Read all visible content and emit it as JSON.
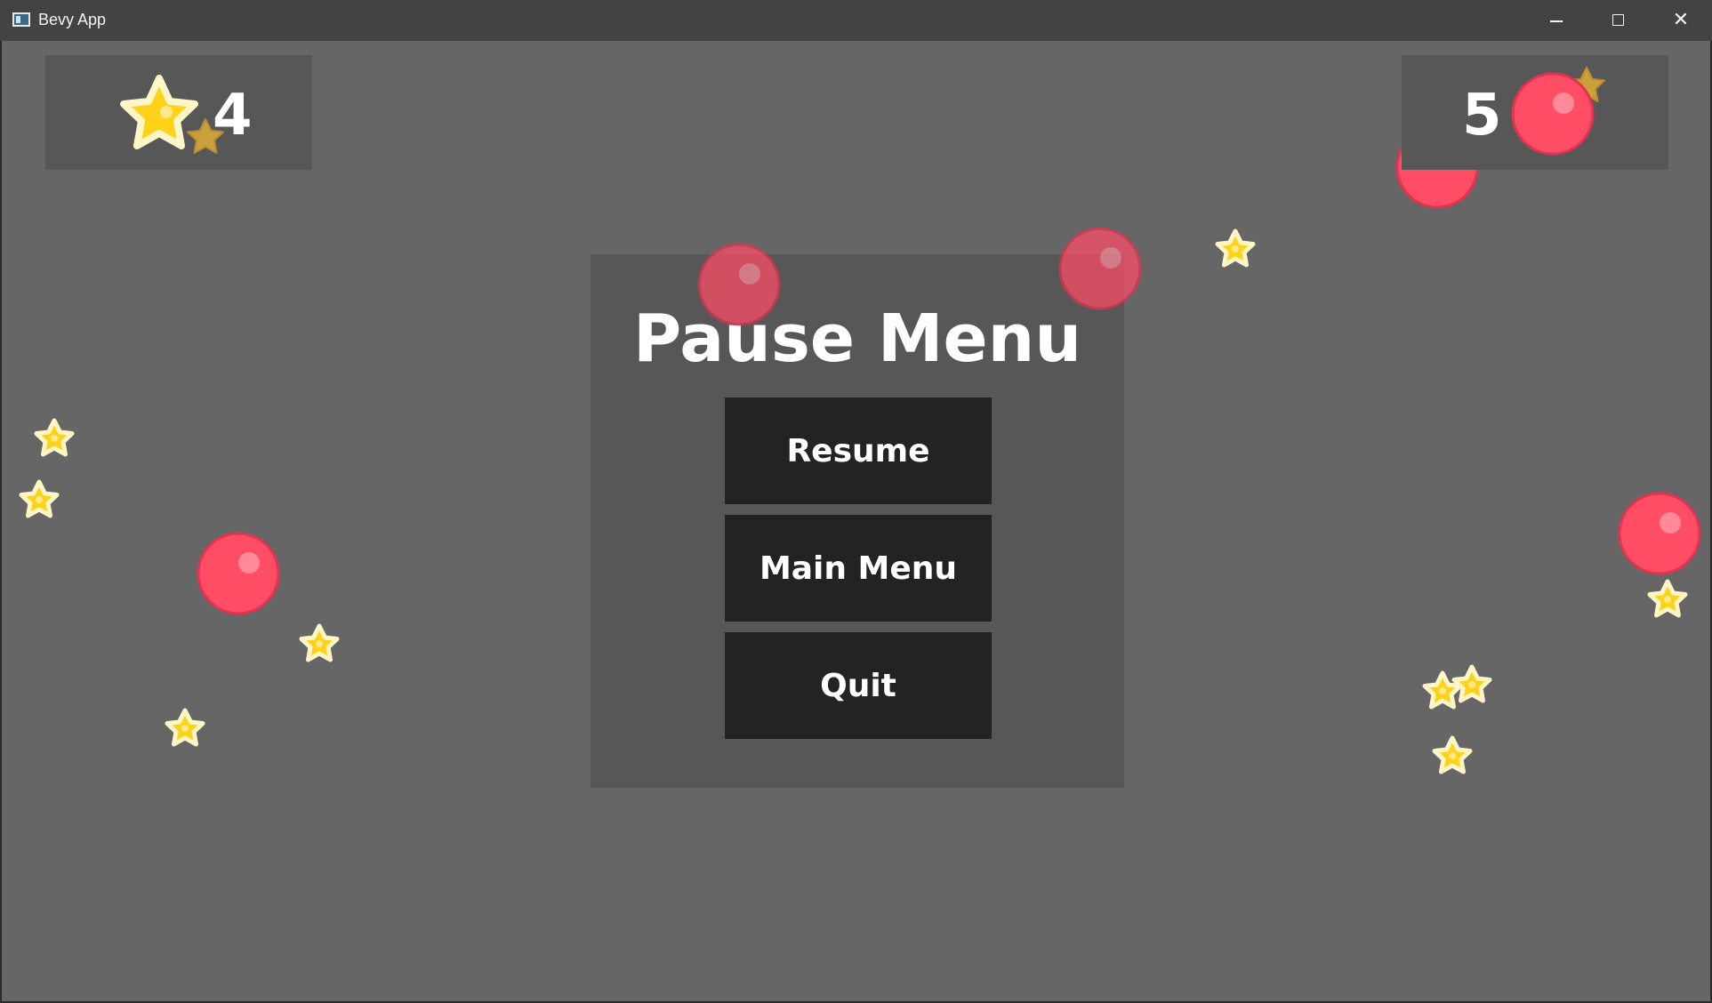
{
  "window": {
    "title": "Bevy App",
    "icons": [
      "app-icon",
      "minimize-icon",
      "maximize-icon",
      "close-icon"
    ]
  },
  "hud": {
    "score": "4",
    "enemy_count": "5",
    "score_icon": "star-icon"
  },
  "pause_menu": {
    "title": "Pause Menu",
    "buttons": [
      {
        "label": "Resume"
      },
      {
        "label": "Main Menu"
      },
      {
        "label": "Quit"
      }
    ]
  },
  "colors": {
    "background": "#666666",
    "panel": "#575757",
    "button": "#232323",
    "text": "#ffffff",
    "star": "#ffd21a",
    "enemy": "#ff4d66"
  }
}
